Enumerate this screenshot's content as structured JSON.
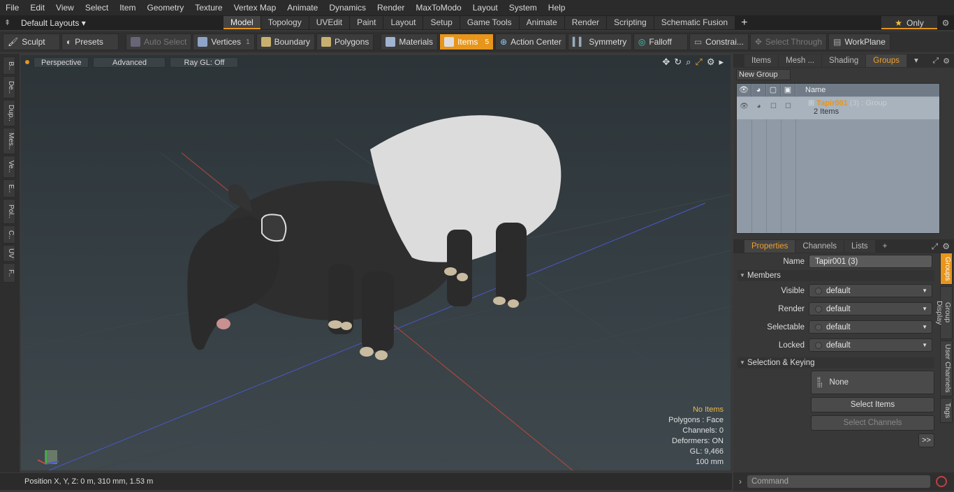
{
  "menu": [
    "File",
    "Edit",
    "View",
    "Select",
    "Item",
    "Geometry",
    "Texture",
    "Vertex Map",
    "Animate",
    "Dynamics",
    "Render",
    "MaxToModo",
    "Layout",
    "System",
    "Help"
  ],
  "layout_dropdown": "Default Layouts ▾",
  "layout_tabs": [
    "Model",
    "Topology",
    "UVEdit",
    "Paint",
    "Layout",
    "Setup",
    "Game Tools",
    "Animate",
    "Render",
    "Scripting",
    "Schematic Fusion"
  ],
  "only_label": "Only",
  "toolbar": {
    "sculpt": "Sculpt",
    "presets": "Presets",
    "auto_select": "Auto Select",
    "vertices": "Vertices",
    "vertices_count": "1",
    "boundary": "Boundary",
    "polygons": "Polygons",
    "materials": "Materials",
    "items": "Items",
    "items_count": "5",
    "action_center": "Action Center",
    "symmetry": "Symmetry",
    "falloff": "Falloff",
    "constraints": "Constrai...",
    "select_through": "Select Through",
    "workplane": "WorkPlane"
  },
  "left_tabs": [
    "B..",
    "De..",
    "Dup..",
    "Mes..",
    "Ve..",
    "E..",
    "Pol..",
    "C..",
    "UV",
    "F.."
  ],
  "viewport": {
    "view_mode": "Perspective",
    "shading": "Advanced",
    "raygl": "Ray GL: Off",
    "hud": [
      "No Items",
      "Polygons : Face",
      "Channels: 0",
      "Deformers: ON",
      "GL: 9,466",
      "100 mm"
    ]
  },
  "status": "Position X, Y, Z:   0 m, 310 mm, 1.53 m",
  "top_panel": {
    "tabs": [
      "Items",
      "Mesh ...",
      "Shading",
      "Groups"
    ],
    "new_group": "New Group",
    "col_name": "Name",
    "group": {
      "name": "Tapir001",
      "count": "(3)",
      "type": ": Group",
      "items": "2 Items"
    }
  },
  "props_panel": {
    "tabs": [
      "Properties",
      "Channels",
      "Lists"
    ],
    "name_label": "Name",
    "name_value": "Tapir001 (3)",
    "members": "Members",
    "rows": [
      {
        "label": "Visible",
        "value": "default"
      },
      {
        "label": "Render",
        "value": "default"
      },
      {
        "label": "Selectable",
        "value": "default"
      },
      {
        "label": "Locked",
        "value": "default"
      }
    ],
    "selection_keying": "Selection & Keying",
    "none": "None",
    "select_items": "Select Items",
    "select_channels": "Select Channels",
    "more": ">>"
  },
  "right_vtabs": [
    "Groups",
    "Group Display",
    "User Channels",
    "Tags"
  ],
  "command_placeholder": "Command"
}
